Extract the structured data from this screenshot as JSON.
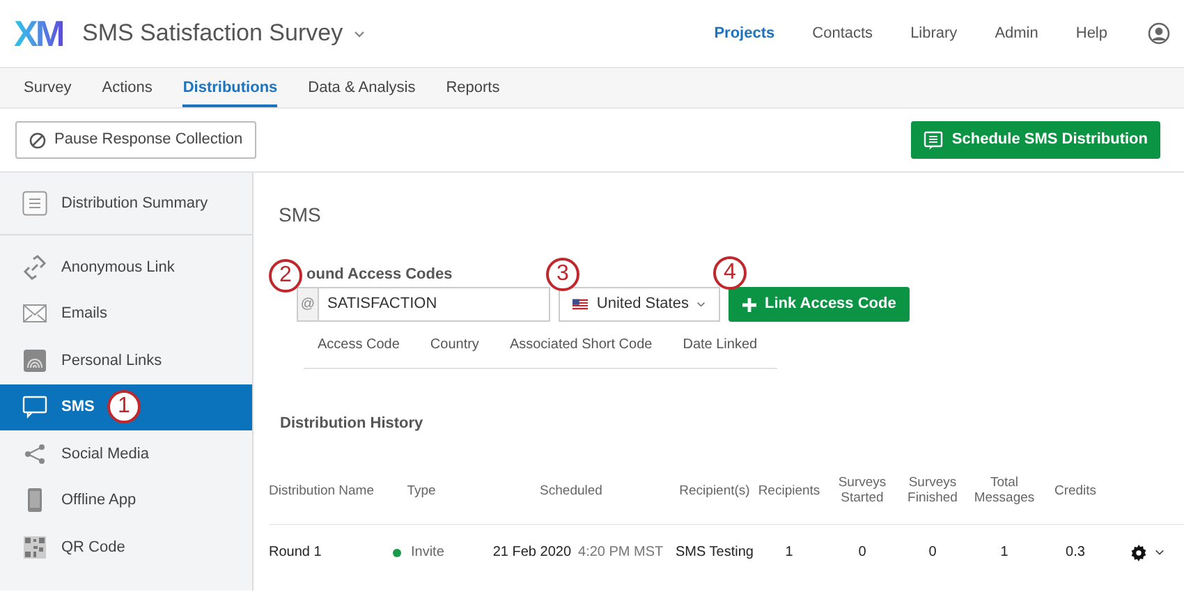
{
  "header": {
    "logo": "XM",
    "survey_title": "SMS Satisfaction Survey",
    "nav": [
      {
        "label": "Projects",
        "selected": true
      },
      {
        "label": "Contacts",
        "selected": false
      },
      {
        "label": "Library",
        "selected": false
      },
      {
        "label": "Admin",
        "selected": false
      },
      {
        "label": "Help",
        "selected": false
      }
    ]
  },
  "tabs": [
    {
      "label": "Survey",
      "selected": false
    },
    {
      "label": "Actions",
      "selected": false
    },
    {
      "label": "Distributions",
      "selected": true
    },
    {
      "label": "Data & Analysis",
      "selected": false
    },
    {
      "label": "Reports",
      "selected": false
    }
  ],
  "toolbar": {
    "pause_button": "Pause Response Collection",
    "schedule_button": "Schedule SMS Distribution"
  },
  "sidebar": {
    "summary": "Distribution Summary",
    "items": [
      {
        "kind": "link",
        "label": "Anonymous Link",
        "selected": false
      },
      {
        "kind": "email",
        "label": "Emails",
        "selected": false
      },
      {
        "kind": "fingerprint",
        "label": "Personal Links",
        "selected": false
      },
      {
        "kind": "sms",
        "label": "SMS",
        "selected": true,
        "callout": "1"
      },
      {
        "kind": "share",
        "label": "Social Media",
        "selected": false
      },
      {
        "kind": "phone",
        "label": "Offline App",
        "selected": false
      },
      {
        "kind": "qr",
        "label": "QR Code",
        "selected": false
      }
    ]
  },
  "main": {
    "title": "SMS",
    "access_codes": {
      "heading": "ound Access Codes",
      "prefix": "@",
      "value": "SATISFACTION",
      "input_callout": "2",
      "country": "United States",
      "country_callout": "3",
      "link_button": "Link Access Code",
      "button_callout": "4",
      "columns": [
        "Access Code",
        "Country",
        "Associated Short Code",
        "Date Linked"
      ]
    },
    "history": {
      "heading": "Distribution History",
      "columns": [
        "Distribution Name",
        "Type",
        "Scheduled",
        "Recipient(s)",
        "Recipients",
        "Surveys Started",
        "Surveys Finished",
        "Total Messages",
        "Credits"
      ],
      "rows": [
        {
          "name": "Round 1",
          "type": "Invite",
          "color": "#1a9a4a",
          "date": "21 Feb 2020",
          "time": "4:20 PM MST",
          "recipient_list": "SMS Testing",
          "recipients": "1",
          "started": "0",
          "finished": "0",
          "total": "1",
          "credits": "0.3"
        }
      ]
    }
  }
}
